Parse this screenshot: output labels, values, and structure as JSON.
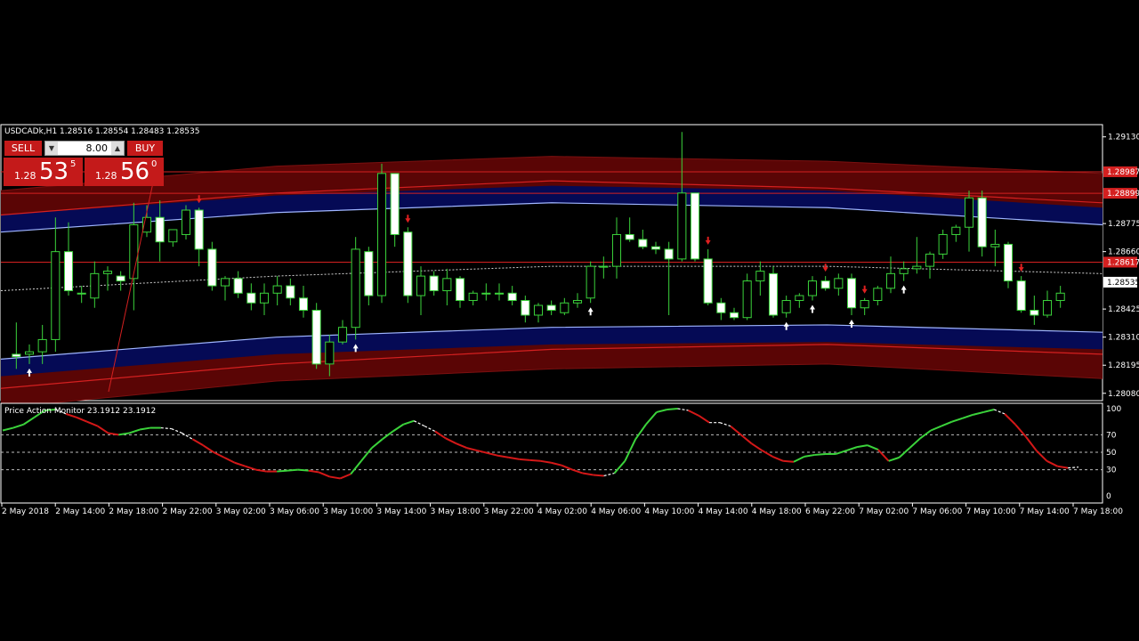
{
  "window": {
    "symbol_header": "USDCADk,H1  1.28516 1.28554 1.28483 1.28535",
    "collapse_glyph": "▲"
  },
  "trade_panel": {
    "sell_label": "SELL",
    "buy_label": "BUY",
    "lot": "8.00",
    "sell_price": {
      "prefix": "1.28",
      "big": "53",
      "sup": "5"
    },
    "buy_price": {
      "prefix": "1.28",
      "big": "56",
      "sup": "0"
    }
  },
  "colors": {
    "bull": "#3bd33b",
    "bear": "#ffffff",
    "wick": "#3bd33b",
    "up_arrow": "#ffffff",
    "down_arrow": "#e02020",
    "red_band": "#5a0505",
    "blue_band": "#050a55",
    "red_line": "#d42020",
    "osc_up": "#3bd33b",
    "osc_down": "#d41818",
    "osc_flat": "#ffffff"
  },
  "price_axis": {
    "ticks": [
      "1.29130",
      "1.28775",
      "1.28660",
      "1.28425",
      "1.28310",
      "1.28195",
      "1.28080"
    ],
    "tags": [
      {
        "label": "1.28987",
        "value": 1.28987,
        "kind": "red"
      },
      {
        "label": "1.28899",
        "value": 1.28899,
        "kind": "red"
      },
      {
        "label": "1.28617",
        "value": 1.28617,
        "kind": "red"
      },
      {
        "label": "1.28535",
        "value": 1.28535,
        "kind": "white"
      }
    ]
  },
  "indicator": {
    "title": "Price Action Monitor 23.1912 23.1912",
    "levels": [
      100,
      70,
      50,
      30,
      0
    ],
    "level_labels": [
      "100",
      "70",
      "50",
      "30",
      "0"
    ]
  },
  "time_axis": {
    "labels": [
      "2 May 2018",
      "2 May 14:00",
      "2 May 18:00",
      "2 May 22:00",
      "3 May 02:00",
      "3 May 06:00",
      "3 May 10:00",
      "3 May 14:00",
      "3 May 18:00",
      "3 May 22:00",
      "4 May 02:00",
      "4 May 06:00",
      "4 May 10:00",
      "4 May 14:00",
      "4 May 18:00",
      "6 May 22:00",
      "7 May 02:00",
      "7 May 06:00",
      "7 May 10:00",
      "7 May 14:00",
      "7 May 18:00"
    ]
  },
  "chart_data": [
    {
      "type": "candlestick",
      "symbol": "USDCADk",
      "timeframe": "H1",
      "ylim": [
        1.2805,
        1.2918
      ],
      "candles": [
        {
          "o": 1.2824,
          "h": 1.2837,
          "l": 1.2818,
          "c": 1.2823
        },
        {
          "o": 1.2824,
          "h": 1.2828,
          "l": 1.282,
          "c": 1.2825
        },
        {
          "o": 1.2825,
          "h": 1.2836,
          "l": 1.282,
          "c": 1.283
        },
        {
          "o": 1.283,
          "h": 1.288,
          "l": 1.2825,
          "c": 1.2866
        },
        {
          "o": 1.2866,
          "h": 1.2878,
          "l": 1.2848,
          "c": 1.285
        },
        {
          "o": 1.2849,
          "h": 1.2852,
          "l": 1.2845,
          "c": 1.2849
        },
        {
          "o": 1.2847,
          "h": 1.2862,
          "l": 1.2843,
          "c": 1.2857
        },
        {
          "o": 1.2857,
          "h": 1.286,
          "l": 1.285,
          "c": 1.2858
        },
        {
          "o": 1.2856,
          "h": 1.2858,
          "l": 1.285,
          "c": 1.2854
        },
        {
          "o": 1.2855,
          "h": 1.2886,
          "l": 1.2842,
          "c": 1.2877
        },
        {
          "o": 1.2874,
          "h": 1.2885,
          "l": 1.2872,
          "c": 1.288
        },
        {
          "o": 1.288,
          "h": 1.2887,
          "l": 1.2862,
          "c": 1.287
        },
        {
          "o": 1.287,
          "h": 1.2875,
          "l": 1.2868,
          "c": 1.2875
        },
        {
          "o": 1.2873,
          "h": 1.2885,
          "l": 1.2871,
          "c": 1.2883
        },
        {
          "o": 1.2883,
          "h": 1.2884,
          "l": 1.286,
          "c": 1.2867
        },
        {
          "o": 1.2867,
          "h": 1.287,
          "l": 1.285,
          "c": 1.2852
        },
        {
          "o": 1.2852,
          "h": 1.2856,
          "l": 1.2846,
          "c": 1.2855
        },
        {
          "o": 1.2855,
          "h": 1.2858,
          "l": 1.2847,
          "c": 1.2849
        },
        {
          "o": 1.2849,
          "h": 1.2853,
          "l": 1.2842,
          "c": 1.2845
        },
        {
          "o": 1.2845,
          "h": 1.2853,
          "l": 1.284,
          "c": 1.2849
        },
        {
          "o": 1.2849,
          "h": 1.2856,
          "l": 1.2844,
          "c": 1.2852
        },
        {
          "o": 1.2852,
          "h": 1.2855,
          "l": 1.2844,
          "c": 1.2847
        },
        {
          "o": 1.2847,
          "h": 1.2852,
          "l": 1.2839,
          "c": 1.2842
        },
        {
          "o": 1.2842,
          "h": 1.2845,
          "l": 1.2818,
          "c": 1.282
        },
        {
          "o": 1.282,
          "h": 1.2832,
          "l": 1.2815,
          "c": 1.2829
        },
        {
          "o": 1.2829,
          "h": 1.2838,
          "l": 1.2828,
          "c": 1.2835
        },
        {
          "o": 1.2835,
          "h": 1.2872,
          "l": 1.283,
          "c": 1.2867
        },
        {
          "o": 1.2866,
          "h": 1.2868,
          "l": 1.2844,
          "c": 1.2848
        },
        {
          "o": 1.2848,
          "h": 1.2902,
          "l": 1.2845,
          "c": 1.2898
        },
        {
          "o": 1.2898,
          "h": 1.2898,
          "l": 1.2868,
          "c": 1.2873
        },
        {
          "o": 1.2874,
          "h": 1.2876,
          "l": 1.2845,
          "c": 1.2848
        },
        {
          "o": 1.2848,
          "h": 1.286,
          "l": 1.284,
          "c": 1.2856
        },
        {
          "o": 1.2856,
          "h": 1.2858,
          "l": 1.2848,
          "c": 1.285
        },
        {
          "o": 1.285,
          "h": 1.2859,
          "l": 1.2844,
          "c": 1.2855
        },
        {
          "o": 1.2855,
          "h": 1.2856,
          "l": 1.2843,
          "c": 1.2846
        },
        {
          "o": 1.2846,
          "h": 1.285,
          "l": 1.2844,
          "c": 1.2849
        },
        {
          "o": 1.2849,
          "h": 1.2853,
          "l": 1.2846,
          "c": 1.2849
        },
        {
          "o": 1.2849,
          "h": 1.2853,
          "l": 1.2846,
          "c": 1.2849
        },
        {
          "o": 1.2849,
          "h": 1.2852,
          "l": 1.2844,
          "c": 1.2846
        },
        {
          "o": 1.2846,
          "h": 1.2848,
          "l": 1.2837,
          "c": 1.284
        },
        {
          "o": 1.284,
          "h": 1.2845,
          "l": 1.2837,
          "c": 1.2844
        },
        {
          "o": 1.2844,
          "h": 1.2846,
          "l": 1.284,
          "c": 1.2842
        },
        {
          "o": 1.2841,
          "h": 1.2847,
          "l": 1.284,
          "c": 1.2845
        },
        {
          "o": 1.2845,
          "h": 1.2849,
          "l": 1.2843,
          "c": 1.2846
        },
        {
          "o": 1.2847,
          "h": 1.2862,
          "l": 1.2845,
          "c": 1.286
        },
        {
          "o": 1.286,
          "h": 1.2864,
          "l": 1.2855,
          "c": 1.286
        },
        {
          "o": 1.286,
          "h": 1.288,
          "l": 1.2855,
          "c": 1.2873
        },
        {
          "o": 1.2873,
          "h": 1.288,
          "l": 1.287,
          "c": 1.2871
        },
        {
          "o": 1.2871,
          "h": 1.2875,
          "l": 1.2867,
          "c": 1.2868
        },
        {
          "o": 1.2868,
          "h": 1.287,
          "l": 1.2865,
          "c": 1.2867
        },
        {
          "o": 1.2867,
          "h": 1.287,
          "l": 1.284,
          "c": 1.2863
        },
        {
          "o": 1.2863,
          "h": 1.2915,
          "l": 1.2862,
          "c": 1.289
        },
        {
          "o": 1.289,
          "h": 1.289,
          "l": 1.2862,
          "c": 1.2863
        },
        {
          "o": 1.2863,
          "h": 1.2867,
          "l": 1.2844,
          "c": 1.2845
        },
        {
          "o": 1.2845,
          "h": 1.2847,
          "l": 1.2838,
          "c": 1.2841
        },
        {
          "o": 1.2841,
          "h": 1.2843,
          "l": 1.2838,
          "c": 1.2839
        },
        {
          "o": 1.2839,
          "h": 1.2857,
          "l": 1.2838,
          "c": 1.2854
        },
        {
          "o": 1.2854,
          "h": 1.2862,
          "l": 1.2848,
          "c": 1.2858
        },
        {
          "o": 1.2857,
          "h": 1.286,
          "l": 1.2839,
          "c": 1.284
        },
        {
          "o": 1.2841,
          "h": 1.2848,
          "l": 1.2839,
          "c": 1.2846
        },
        {
          "o": 1.2846,
          "h": 1.2849,
          "l": 1.2843,
          "c": 1.2848
        },
        {
          "o": 1.2848,
          "h": 1.2856,
          "l": 1.2846,
          "c": 1.2854
        },
        {
          "o": 1.2854,
          "h": 1.2856,
          "l": 1.285,
          "c": 1.2851
        },
        {
          "o": 1.2851,
          "h": 1.2857,
          "l": 1.2848,
          "c": 1.2855
        },
        {
          "o": 1.2855,
          "h": 1.2857,
          "l": 1.284,
          "c": 1.2843
        },
        {
          "o": 1.2843,
          "h": 1.2847,
          "l": 1.284,
          "c": 1.2846
        },
        {
          "o": 1.2846,
          "h": 1.2852,
          "l": 1.2844,
          "c": 1.2851
        },
        {
          "o": 1.2851,
          "h": 1.2864,
          "l": 1.2849,
          "c": 1.2857
        },
        {
          "o": 1.2857,
          "h": 1.2862,
          "l": 1.2854,
          "c": 1.2859
        },
        {
          "o": 1.2859,
          "h": 1.2872,
          "l": 1.2857,
          "c": 1.286
        },
        {
          "o": 1.286,
          "h": 1.2866,
          "l": 1.2855,
          "c": 1.2865
        },
        {
          "o": 1.2865,
          "h": 1.2875,
          "l": 1.2863,
          "c": 1.2873
        },
        {
          "o": 1.2873,
          "h": 1.2877,
          "l": 1.287,
          "c": 1.2876
        },
        {
          "o": 1.2876,
          "h": 1.2891,
          "l": 1.2866,
          "c": 1.2888
        },
        {
          "o": 1.2888,
          "h": 1.2891,
          "l": 1.2864,
          "c": 1.2868
        },
        {
          "o": 1.2868,
          "h": 1.2875,
          "l": 1.286,
          "c": 1.2869
        },
        {
          "o": 1.2869,
          "h": 1.287,
          "l": 1.2851,
          "c": 1.2854
        },
        {
          "o": 1.2854,
          "h": 1.2856,
          "l": 1.2841,
          "c": 1.2842
        },
        {
          "o": 1.2842,
          "h": 1.2848,
          "l": 1.2836,
          "c": 1.284
        },
        {
          "o": 1.284,
          "h": 1.285,
          "l": 1.2839,
          "c": 1.2846
        },
        {
          "o": 1.2846,
          "h": 1.2852,
          "l": 1.2843,
          "c": 1.2849
        }
      ],
      "markers": [
        {
          "index": 1,
          "dir": "up"
        },
        {
          "index": 14,
          "dir": "down"
        },
        {
          "index": 26,
          "dir": "up"
        },
        {
          "index": 30,
          "dir": "down"
        },
        {
          "index": 44,
          "dir": "up"
        },
        {
          "index": 53,
          "dir": "down"
        },
        {
          "index": 59,
          "dir": "up"
        },
        {
          "index": 61,
          "dir": "up"
        },
        {
          "index": 62,
          "dir": "down"
        },
        {
          "index": 64,
          "dir": "up"
        },
        {
          "index": 65,
          "dir": "down"
        },
        {
          "index": 68,
          "dir": "up"
        },
        {
          "index": 77,
          "dir": "down"
        }
      ],
      "bands": {
        "red_outer_upper": [
          1.2891,
          1.2901,
          1.2905,
          1.2903,
          1.2898
        ],
        "red_mid_upper": [
          1.2881,
          1.289,
          1.2895,
          1.2892,
          1.2886
        ],
        "blue_upper": [
          1.2874,
          1.2882,
          1.2886,
          1.2884,
          1.2877
        ],
        "midline": [
          1.285,
          1.2856,
          1.286,
          1.286,
          1.2857
        ],
        "blue_lower": [
          1.2822,
          1.2831,
          1.2835,
          1.2836,
          1.2833
        ],
        "red_mid_lower": [
          1.281,
          1.282,
          1.2826,
          1.2828,
          1.2824
        ],
        "red_outer_lower": [
          1.2802,
          1.2813,
          1.2818,
          1.282,
          1.2814
        ]
      },
      "hlines": [
        1.28987,
        1.28899,
        1.28617
      ]
    },
    {
      "type": "line",
      "title": "Price Action Monitor 23.1912 23.1912",
      "ylim": [
        0,
        100
      ],
      "values": [
        75,
        78,
        82,
        90,
        98,
        99,
        94,
        90,
        85,
        80,
        72,
        70,
        72,
        76,
        78,
        78,
        77,
        72,
        65,
        58,
        50,
        44,
        38,
        34,
        30,
        28,
        28,
        29,
        30,
        29,
        27,
        22,
        20,
        25,
        40,
        55,
        65,
        74,
        82,
        86,
        80,
        74,
        66,
        60,
        55,
        52,
        49,
        46,
        44,
        42,
        41,
        40,
        38,
        35,
        30,
        26,
        24,
        23,
        26,
        40,
        65,
        82,
        96,
        99,
        100,
        98,
        92,
        84,
        84,
        80,
        70,
        60,
        52,
        45,
        40,
        39,
        45,
        47,
        48,
        48,
        52,
        56,
        58,
        53,
        40,
        44,
        55,
        66,
        75,
        80,
        85,
        89,
        93,
        96,
        99,
        94,
        82,
        68,
        52,
        40,
        34,
        32,
        33
      ],
      "colors": [
        "up",
        "up",
        "up",
        "up",
        "up",
        "flat",
        "down",
        "down",
        "down",
        "down",
        "down",
        "up",
        "up",
        "up",
        "up",
        "flat",
        "flat",
        "flat",
        "down",
        "down",
        "down",
        "down",
        "down",
        "down",
        "down",
        "down",
        "up",
        "up",
        "up",
        "down",
        "down",
        "down",
        "down",
        "up",
        "up",
        "up",
        "up",
        "up",
        "up",
        "flat",
        "flat",
        "down",
        "down",
        "down",
        "down",
        "down",
        "down",
        "down",
        "down",
        "down",
        "down",
        "down",
        "down",
        "down",
        "down",
        "down",
        "down",
        "flat",
        "up",
        "up",
        "up",
        "up",
        "up",
        "up",
        "flat",
        "down",
        "down",
        "flat",
        "flat",
        "down",
        "down",
        "down",
        "down",
        "down",
        "down",
        "up",
        "up",
        "up",
        "up",
        "up",
        "up",
        "up",
        "up",
        "down",
        "up",
        "up",
        "up",
        "up",
        "up",
        "up",
        "up",
        "up",
        "up",
        "up",
        "flat",
        "down",
        "down",
        "down",
        "down",
        "down",
        "down",
        "flat",
        "flat"
      ]
    }
  ]
}
